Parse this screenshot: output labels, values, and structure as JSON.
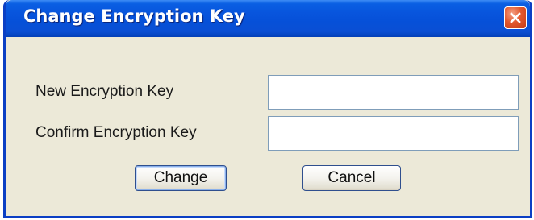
{
  "window": {
    "title": "Change Encryption Key",
    "close_icon": "close-icon"
  },
  "form": {
    "new_key": {
      "label": "New Encryption Key",
      "value": ""
    },
    "confirm_key": {
      "label": "Confirm Encryption Key",
      "value": ""
    }
  },
  "buttons": {
    "change_label": "Change",
    "cancel_label": "Cancel"
  },
  "colors": {
    "titlebar": "#0855dd",
    "window_body": "#ece9d8",
    "close_button": "#e2582e"
  }
}
